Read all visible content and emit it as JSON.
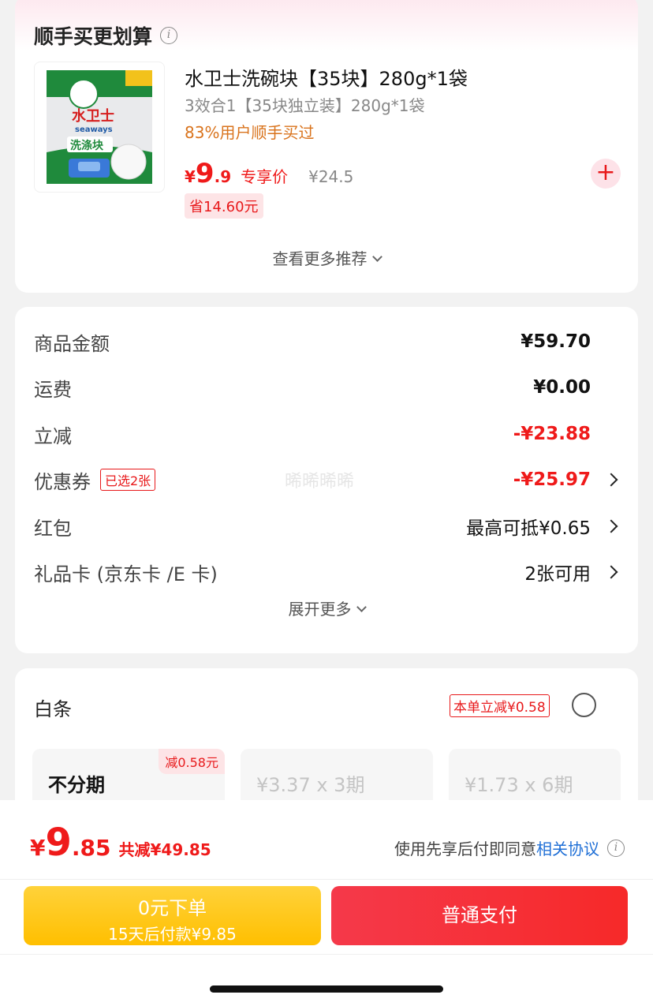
{
  "recommend": {
    "title": "顺手买更划算",
    "product": {
      "name": "水卫士洗碗块【35块】280g*1袋",
      "spec": "3效合1【35块独立装】280g*1袋",
      "buy_rate": "83%用户顺手买过",
      "price_currency": "¥",
      "price_int": "9",
      "price_dec": ".9",
      "price_tag": "专享价",
      "original_price": "¥24.5",
      "save": "省14.60元",
      "add_label": "+",
      "image_brand": "水卫士",
      "image_brand_en": "seaways",
      "image_text": "洗涤块"
    },
    "more_label": "查看更多推荐"
  },
  "summary": {
    "rows": [
      {
        "label": "商品金额",
        "value": "¥59.70"
      },
      {
        "label": "运费",
        "value": "¥0.00"
      },
      {
        "label": "立减",
        "value": "-¥23.88"
      },
      {
        "label": "优惠券",
        "badge": "已选2张",
        "value": "-¥25.97"
      },
      {
        "label": "红包",
        "value": "最高可抵¥0.65"
      },
      {
        "label": "礼品卡 (京东卡 /E 卡)",
        "value": "2张可用"
      }
    ],
    "watermark": "晞晞晞晞",
    "expand_label": "展开更多"
  },
  "baitiao": {
    "title": "白条",
    "promo": "本单立减¥0.58",
    "plans": [
      {
        "label": "不分期",
        "badge": "减0.58元"
      },
      {
        "label": "¥3.37 x 3期"
      },
      {
        "label": "¥1.73 x 6期"
      }
    ]
  },
  "bottom": {
    "total_currency": "¥",
    "total_int": "9",
    "total_dec": ".85",
    "total_reduce": "共减¥49.85",
    "agree_text": "使用先享后付即同意",
    "agree_link": "相关协议",
    "bnpl_main": "0元下单",
    "bnpl_sub": "15天后付款¥9.85",
    "pay_label": "普通支付"
  },
  "colors": {
    "accent_red": "#ef1a1a",
    "bnpl_yellow": "#ffc107",
    "link_blue": "#1f6fd6"
  }
}
